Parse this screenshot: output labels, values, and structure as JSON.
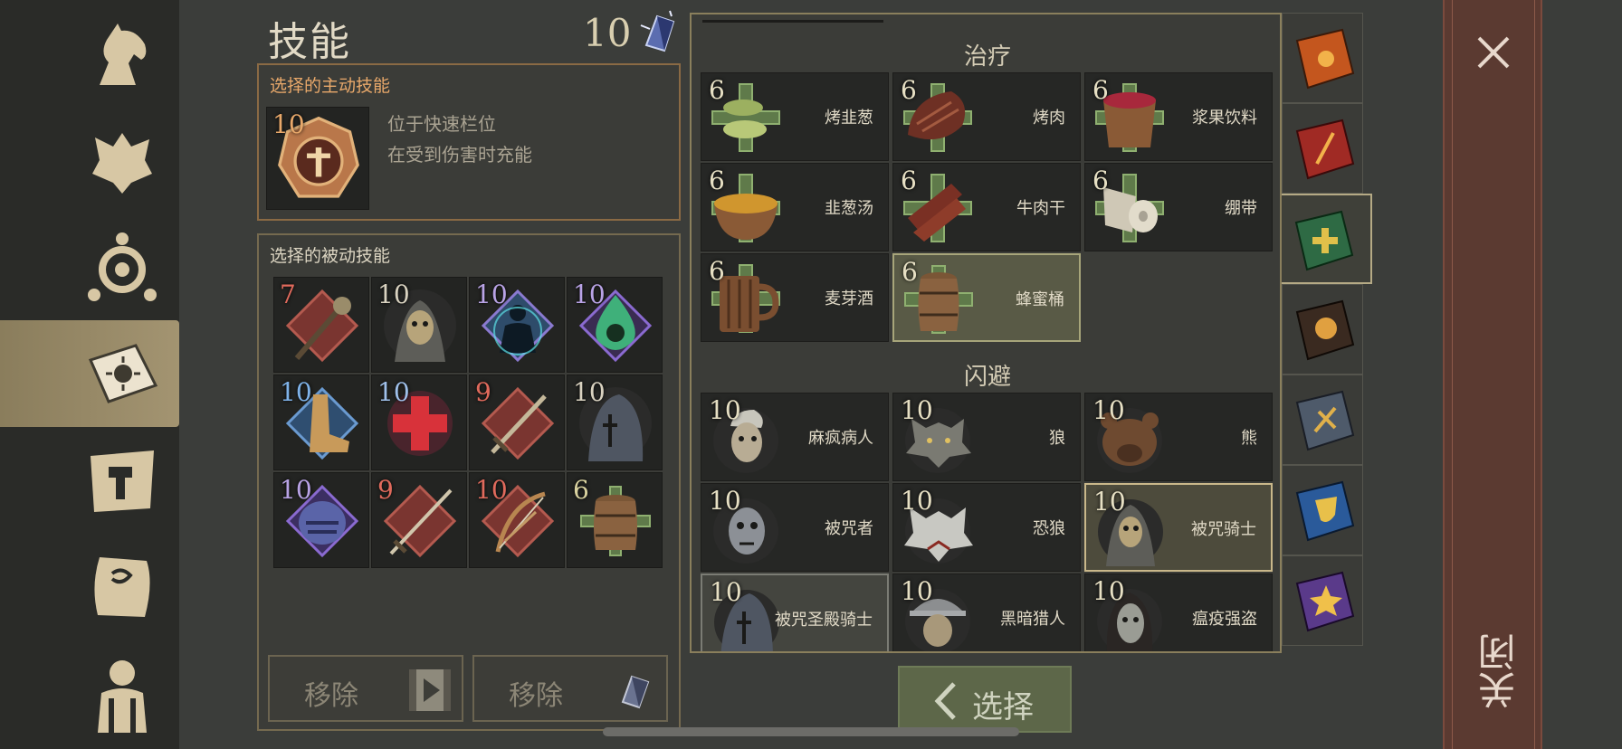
{
  "header": {
    "title": "技能",
    "skill_points": "10"
  },
  "active_skill": {
    "section_label": "选择的主动技能",
    "level": "10",
    "desc_line1": "位于快速栏位",
    "desc_line2": "在受到伤害时充能"
  },
  "passive_skills": {
    "section_label": "选择的被动技能",
    "tiles": [
      {
        "level": "7",
        "level_color": "#e06a5c",
        "icon": "mace-icon"
      },
      {
        "level": "10",
        "level_color": "#d9d2c0",
        "icon": "undead-knight-icon"
      },
      {
        "level": "10",
        "level_color": "#b9a3e6",
        "icon": "spirit-icon"
      },
      {
        "level": "10",
        "level_color": "#b9a3e6",
        "icon": "poison-skull-icon"
      },
      {
        "level": "10",
        "level_color": "#7fb3ea",
        "icon": "boot-icon"
      },
      {
        "level": "10",
        "level_color": "#9fc0ea",
        "icon": "red-cross-icon"
      },
      {
        "level": "9",
        "level_color": "#e06a5c",
        "icon": "sword-icon"
      },
      {
        "level": "10",
        "level_color": "#d9d2c0",
        "icon": "hooded-figure-icon"
      },
      {
        "level": "10",
        "level_color": "#b9a3e6",
        "icon": "armor-icon"
      },
      {
        "level": "9",
        "level_color": "#e06a5c",
        "icon": "long-sword-icon"
      },
      {
        "level": "10",
        "level_color": "#e06a5c",
        "icon": "bow-icon"
      },
      {
        "level": "6",
        "level_color": "#d9d2a0",
        "icon": "barrel-icon"
      }
    ]
  },
  "buttons": {
    "remove_video": "移除",
    "remove_crystal": "移除",
    "select": "选择",
    "close": "关闭"
  },
  "list": {
    "heal_title": "治疗",
    "dodge_title": "闪避",
    "heal_items": [
      {
        "level": "6",
        "name": "烤韭葱",
        "icon": "roast-leek-icon"
      },
      {
        "level": "6",
        "name": "烤肉",
        "icon": "roast-meat-icon"
      },
      {
        "level": "6",
        "name": "浆果饮料",
        "icon": "berry-drink-icon"
      },
      {
        "level": "6",
        "name": "韭葱汤",
        "icon": "leek-soup-icon"
      },
      {
        "level": "6",
        "name": "牛肉干",
        "icon": "beef-jerky-icon"
      },
      {
        "level": "6",
        "name": "绷带",
        "icon": "bandage-icon"
      },
      {
        "level": "6",
        "name": "麦芽酒",
        "icon": "ale-mug-icon"
      },
      {
        "level": "6",
        "name": "蜂蜜桶",
        "icon": "honey-barrel-icon"
      }
    ],
    "dodge_items": [
      {
        "level": "10",
        "name": "麻疯病人",
        "icon": "leper-icon"
      },
      {
        "level": "10",
        "name": "狼",
        "icon": "wolf-icon"
      },
      {
        "level": "10",
        "name": "熊",
        "icon": "bear-icon"
      },
      {
        "level": "10",
        "name": "被咒者",
        "icon": "cursed-one-icon"
      },
      {
        "level": "10",
        "name": "恐狼",
        "icon": "dire-wolf-icon"
      },
      {
        "level": "10",
        "name": "被咒骑士",
        "icon": "cursed-knight-icon"
      },
      {
        "level": "10",
        "name": "被咒圣殿骑士",
        "icon": "cursed-templar-icon"
      },
      {
        "level": "10",
        "name": "黑暗猎人",
        "icon": "dark-hunter-icon"
      },
      {
        "level": "10",
        "name": "瘟疫强盗",
        "icon": "plague-bandit-icon"
      }
    ]
  },
  "nav": {
    "items": [
      "horse-icon",
      "wolf-head-icon",
      "compass-icon",
      "sun-book-icon",
      "hammer-map-icon",
      "scroll-icon",
      "backpack-icon"
    ],
    "active_index": 3
  },
  "category_tabs": [
    "orange-sun-book-icon",
    "red-sword-book-icon",
    "green-cross-book-icon",
    "dark-skull-book-icon",
    "slate-tools-book-icon",
    "blue-shield-book-icon",
    "purple-star-book-icon"
  ],
  "colors": {
    "accent_orange": "#e8a86a",
    "select_green": "#5d6749",
    "close_red": "#5b3a31"
  }
}
